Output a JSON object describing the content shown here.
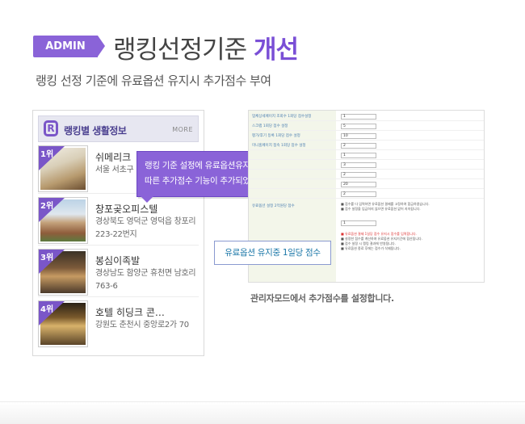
{
  "header": {
    "badge": "ADMIN",
    "title_main": "랭킹선정기준 ",
    "title_emphasis": "개선",
    "subtitle": "랭킹 선정 기준에 유료옵션 유지시 추가점수 부여"
  },
  "ranking_panel": {
    "title": "랭킹별 생활정보",
    "more_label": "MORE",
    "items": [
      {
        "rank": "1위",
        "name": "쉬메리크",
        "address": "서울 서초구"
      },
      {
        "rank": "2위",
        "name": "창포곶오피스텔",
        "address": "경상북도 영덕군 영덕읍 창포리223-22번지"
      },
      {
        "rank": "3위",
        "name": "봉심이족발",
        "address": "경상남도 함양군 휴천면 남호리 763-6"
      },
      {
        "rank": "4위",
        "name": "호텔 히딩크 콘…",
        "address": "강원도 춘천시 중앙로2가 70"
      }
    ]
  },
  "tooltip": {
    "line1": "랭킹 기준 설정에 유료옵션유지기간에",
    "line2": "따른 추가점수 기능이 추가되었습니다."
  },
  "settings": {
    "rows": [
      {
        "label": "업체상세페이지 조회수 1회당 점수설정",
        "value": "1"
      },
      {
        "label": "스크랩 1회당 점수 설정",
        "value": "5"
      },
      {
        "label": "평가/후기 등록 1회당 점수 설정",
        "value": "10"
      },
      {
        "label": "미니홈페이지 접속 1회당 점수 설정",
        "value": "2"
      },
      {
        "label": "",
        "value": "1"
      },
      {
        "label": "",
        "value": "3"
      },
      {
        "label": "",
        "value": "2"
      },
      {
        "label": "",
        "value": "20"
      },
      {
        "label": "",
        "value": "2"
      },
      {
        "label": "",
        "value": "1"
      }
    ],
    "note_label": "유료옵션 설정 2억원당 점수",
    "notes_top": [
      "■ 점수를 다 입력하면 유료옵션 결제를 고정하여 합금하였습니다.",
      "■ 점수 설정을 입금하지 않으면 유료옵션 없어 지속됩니다."
    ],
    "notes_bottom": [
      "■ 유료옵션 결제 1일당 점수 유지시 점수를 입력합니다.",
      "■ 설정한 점수를 계산하여 유료옵션 유지기간에 합산됩니다.",
      "■ 점수 설정 시 랭킹 결과에 반영됩니다.",
      "■ 유료옵션 종료 후에는 점수가 삭제됩니다."
    ]
  },
  "highlight_label": "유료옵션 유지중 1일당 점수",
  "caption": "관리자모드에서 추가점수를 설정합니다."
}
